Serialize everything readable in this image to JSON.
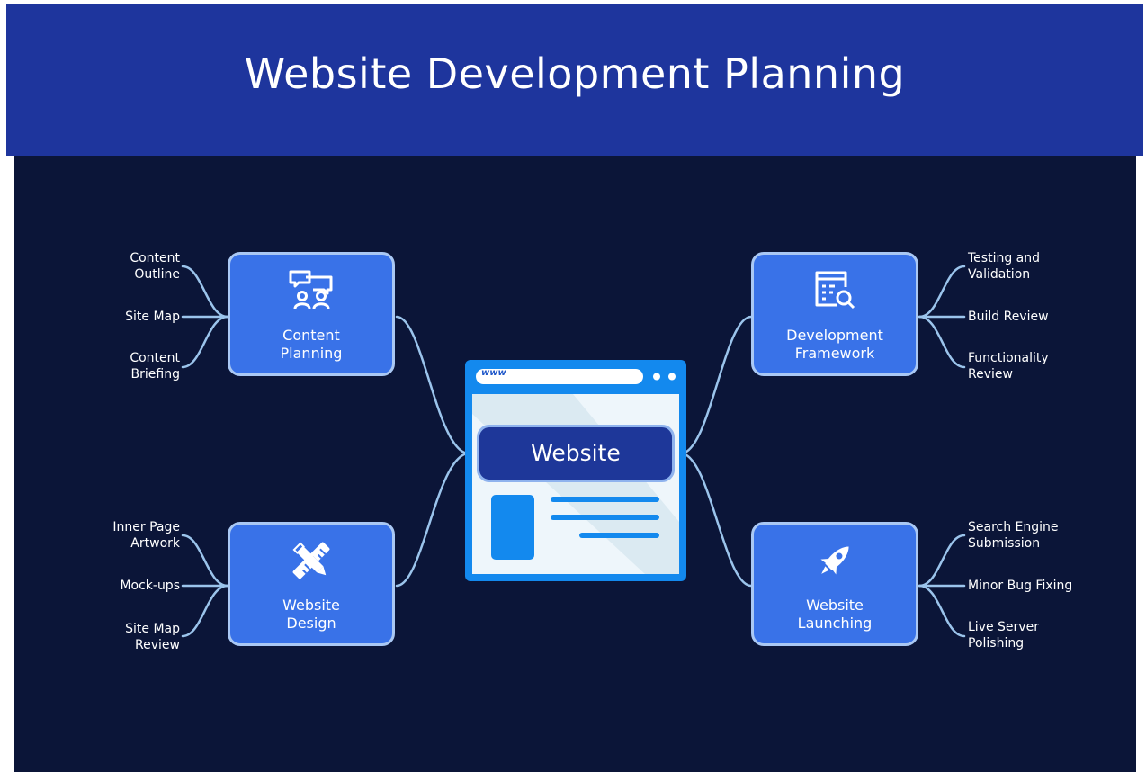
{
  "title": "Website Development Planning",
  "colors": {
    "header_bg": "#1e359d",
    "canvas_bg": "#0b1538",
    "node_fill": "#3972e8",
    "node_border": "#aac8f4",
    "connector": "#9bc4ec",
    "hub_fill": "#1e3799",
    "browser_blue": "#1389ee"
  },
  "center": {
    "label": "Website",
    "url_text": "www",
    "icon": "browser-window-icon"
  },
  "branches": {
    "content_planning": {
      "label": "Content\nPlanning",
      "icon": "meeting-chat-icon",
      "items": [
        "Content\nOutline",
        "Site Map",
        "Content\nBriefing"
      ]
    },
    "website_design": {
      "label": "Website\nDesign",
      "icon": "ruler-pencil-icon",
      "items": [
        "Inner Page\nArtwork",
        "Mock-ups",
        "Site Map\nReview"
      ]
    },
    "development_framework": {
      "label": "Development\nFramework",
      "icon": "document-search-icon",
      "items": [
        "Testing and\nValidation",
        "Build Review",
        "Functionality\nReview"
      ]
    },
    "website_launching": {
      "label": "Website\nLaunching",
      "icon": "rocket-icon",
      "items": [
        "Search Engine\nSubmission",
        "Minor Bug Fixing",
        "Live Server\nPolishing"
      ]
    }
  }
}
